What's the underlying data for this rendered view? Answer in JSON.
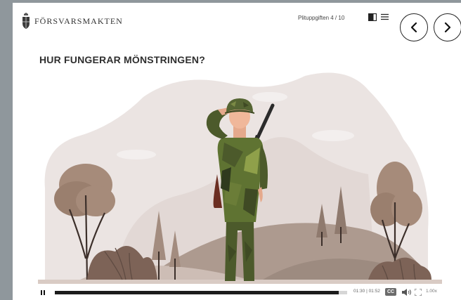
{
  "brand": {
    "name": "FÖRSVARSMAKTEN"
  },
  "header": {
    "progress_label": "Plituppgiften 4 / 10",
    "icons": [
      "book-icon",
      "menu-icon"
    ],
    "nav": {
      "prev_icon": "chevron-left-icon",
      "next_icon": "chevron-right-icon"
    }
  },
  "page": {
    "title": "HUR FUNGERAR MÖNSTRINGEN?"
  },
  "video": {
    "illustration": "soldier-saluting-illustration",
    "progress": 0.97,
    "time_display": "01:30 | 01:52",
    "cc_label": "CC",
    "speed": "1.00x"
  },
  "colors": {
    "background": "#8f979c",
    "accent": "#1c1c1c",
    "olive": "#4c5a2b"
  }
}
